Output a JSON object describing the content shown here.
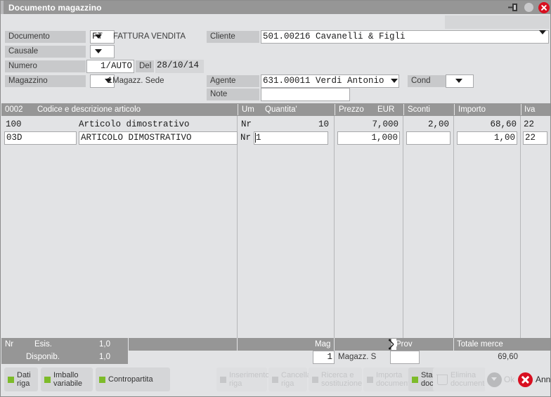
{
  "window": {
    "title": "Documento magazzino",
    "buttons": {
      "minimize": "minimize-icon",
      "restore": "restore-icon",
      "close": "close-icon"
    }
  },
  "header": {
    "documento": {
      "label": "Documento",
      "value": "FT",
      "description": "FATTURA VENDITA"
    },
    "causale": {
      "label": "Causale",
      "value": ""
    },
    "numero": {
      "label": "Numero",
      "value": "1/AUTO"
    },
    "del": {
      "label": "Del",
      "value": "28/10/14"
    },
    "magazzino": {
      "label": "Magazzino",
      "value": "1",
      "description": "Magazz. Sede"
    },
    "cliente": {
      "label": "Cliente",
      "value": "501.00216 Cavanelli & Figli"
    },
    "agente": {
      "label": "Agente",
      "value": "631.00011 Verdi Antonio"
    },
    "cond": {
      "label": "Cond",
      "value": ""
    },
    "note": {
      "label": "Note",
      "value": ""
    }
  },
  "table": {
    "row_counter": "0002",
    "columns": [
      {
        "key": "codice",
        "label": "Codice e descrizione articolo"
      },
      {
        "key": "um",
        "label": "Um"
      },
      {
        "key": "quantita",
        "label": "Quantita'"
      },
      {
        "key": "prezzo",
        "label": "Prezzo"
      },
      {
        "key": "eur",
        "label": "EUR"
      },
      {
        "key": "sconti",
        "label": "Sconti"
      },
      {
        "key": "importo",
        "label": "Importo"
      },
      {
        "key": "iva",
        "label": "Iva"
      }
    ],
    "rows": [
      {
        "codice": "100",
        "descrizione": "Articolo dimostrativo",
        "um": "Nr",
        "quantita": "10",
        "prezzo": "7,000",
        "sconti": "2,00",
        "importo": "68,60",
        "iva": "22"
      }
    ],
    "edit_row": {
      "codice": "03D",
      "descrizione": "ARTICOLO DIMOSTRATIVO",
      "um": "Nr",
      "quantita": "1",
      "prezzo": "1,000",
      "sconti": "",
      "importo": "1,00",
      "iva": "22"
    }
  },
  "footer": {
    "um_label": "Nr",
    "esis_label": "Esis.",
    "esis_value": "1,0",
    "disponib_label": "Disponib.",
    "disponib_value": "1,0",
    "mag_label": "Mag",
    "mag_value": "1",
    "mag_desc": "Magazz. S",
    "prov_label": "Prov",
    "prov_value": "",
    "totale_label": "Totale merce",
    "totale_value": "69,60"
  },
  "toolbar": {
    "left": [
      {
        "name": "dati-riga",
        "label": "Dati\nriga",
        "enabled": true
      },
      {
        "name": "imballo-variabile",
        "label": "Imballo\nvariabile",
        "enabled": true
      },
      {
        "name": "contropartita",
        "label": "Contropartita",
        "enabled": true
      }
    ],
    "right": [
      {
        "name": "inserimento-riga",
        "label": "Inserimento\nriga",
        "enabled": false
      },
      {
        "name": "cancella-riga",
        "label": "Cancella\nriga",
        "enabled": false
      },
      {
        "name": "ricerca-sostituzione",
        "label": "Ricerca e\nsostituzione",
        "enabled": false
      },
      {
        "name": "importa-documento",
        "label": "Importa\ndocumento",
        "enabled": false
      },
      {
        "name": "stampa-documento",
        "label": "Stampa\ndocumento",
        "enabled": true
      },
      {
        "name": "elimina-documento",
        "label": "Elimina\ndocumento",
        "enabled": false
      }
    ],
    "ok_label": "Ok",
    "cancel_label": "Annulla"
  },
  "colors": {
    "titlebar": "#969696",
    "window_bg": "#e2e3e5",
    "label_bg": "#c8c9cb",
    "accent_green": "#7dbb2a",
    "accent_red": "#d80f20",
    "focus_blue": "#5b9bd5"
  }
}
